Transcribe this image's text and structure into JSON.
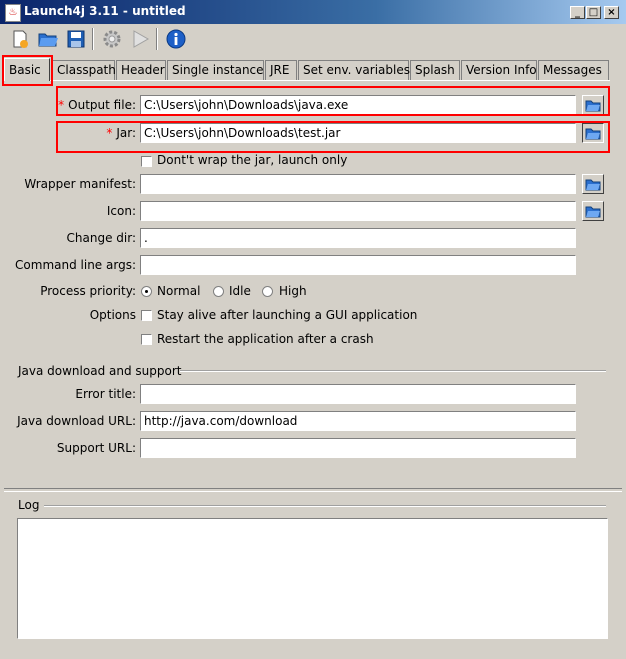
{
  "window": {
    "title": "Launch4j 3.11 - untitled",
    "app_icon_glyph": "♨",
    "min_glyph": "_",
    "max_glyph": "□",
    "close_glyph": "×"
  },
  "toolbar": {
    "icons": [
      "new-file-icon",
      "open-folder-icon",
      "save-icon",
      "gear-icon",
      "run-icon",
      "info-icon"
    ]
  },
  "tabs": [
    "Basic",
    "Classpath",
    "Header",
    "Single instance",
    "JRE",
    "Set env. variables",
    "Splash",
    "Version Info",
    "Messages"
  ],
  "basic": {
    "required_marker": "*",
    "output_file_label": "Output file:",
    "output_file_value": "C:\\Users\\john\\Downloads\\java.exe",
    "jar_label": "Jar:",
    "jar_value": "C:\\Users\\john\\Downloads\\test.jar",
    "dont_wrap_label": "Dont't wrap the jar, launch only",
    "wrapper_manifest_label": "Wrapper manifest:",
    "wrapper_manifest_value": "",
    "icon_label": "Icon:",
    "icon_value": "",
    "change_dir_label": "Change dir:",
    "change_dir_value": ".",
    "cmd_args_label": "Command line args:",
    "cmd_args_value": "",
    "priority_label": "Process priority:",
    "priority_options": [
      "Normal",
      "Idle",
      "High"
    ],
    "priority_selected": "Normal",
    "options_label": "Options",
    "stay_alive_label": "Stay alive after launching a GUI application",
    "restart_label": "Restart the application after a crash"
  },
  "java_download": {
    "section_title": "Java download and support",
    "error_title_label": "Error title:",
    "error_title_value": "",
    "download_url_label": "Java download URL:",
    "download_url_value": "http://java.com/download",
    "support_url_label": "Support URL:",
    "support_url_value": ""
  },
  "log": {
    "title": "Log",
    "content": ""
  },
  "colors": {
    "highlight": "#ff0000",
    "window_bg": "#d4d0c8",
    "title_blue": "#0a246a"
  }
}
